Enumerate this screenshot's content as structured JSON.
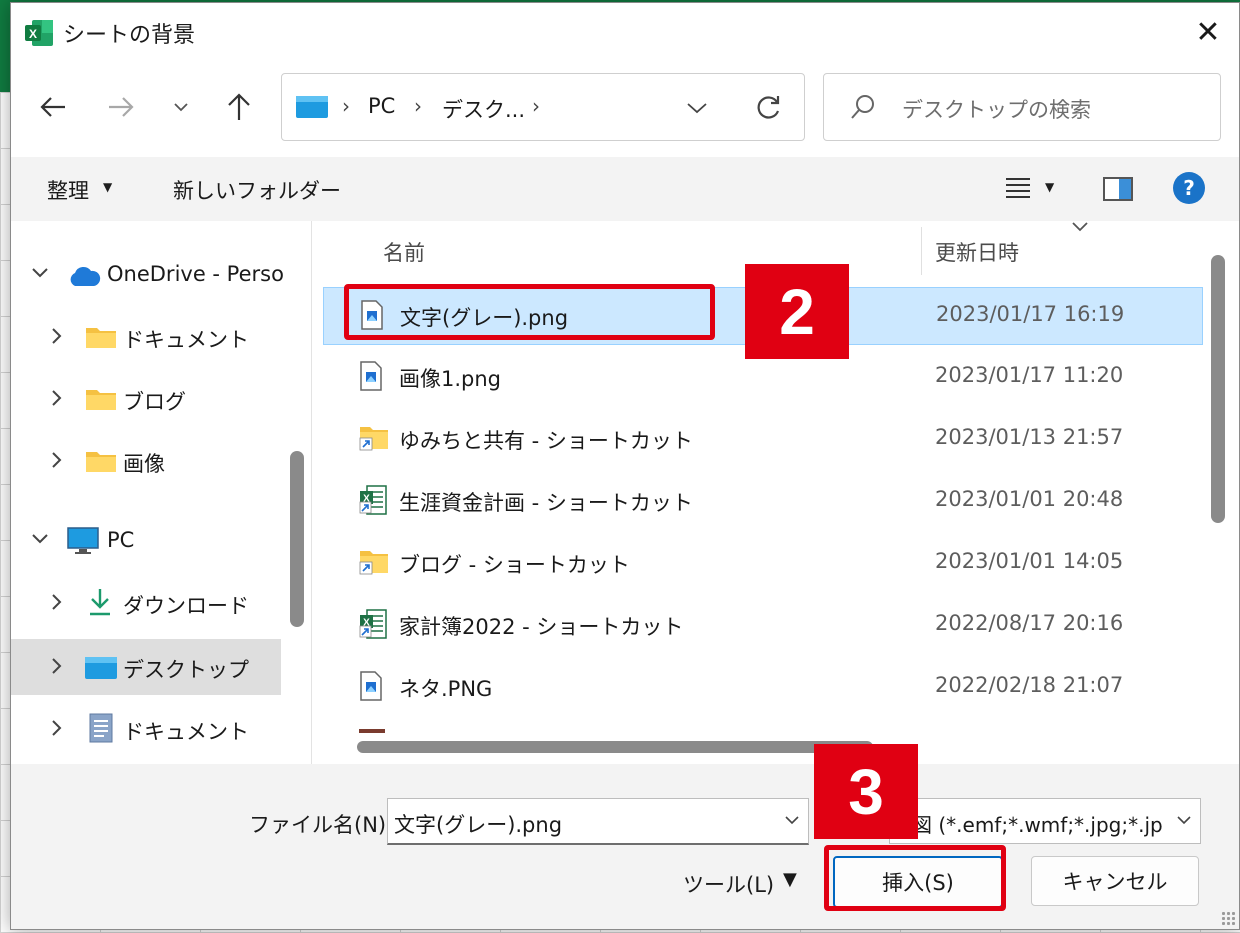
{
  "dialog": {
    "title": "シートの背景",
    "close_glyph": "✕"
  },
  "nav": {
    "breadcrumb": [
      "PC",
      "デスク..."
    ],
    "breadcrumb_sep": "›",
    "search_placeholder": "デスクトップの検索"
  },
  "toolbar": {
    "organize_label": "整理",
    "new_folder_label": "新しいフォルダー",
    "help_glyph": "?"
  },
  "tree": {
    "items": [
      {
        "label": "OneDrive - Perso",
        "expanded": true,
        "icon": "cloud-icon"
      },
      {
        "label": "ドキュメント",
        "icon": "folder-icon"
      },
      {
        "label": "ブログ",
        "icon": "folder-icon"
      },
      {
        "label": "画像",
        "icon": "folder-icon"
      },
      {
        "label": "PC",
        "expanded": true,
        "icon": "monitor-icon"
      },
      {
        "label": "ダウンロード",
        "icon": "download-icon"
      },
      {
        "label": "デスクトップ",
        "icon": "desktop-icon",
        "selected": true
      },
      {
        "label": "ドキュメント",
        "icon": "document-icon"
      }
    ]
  },
  "files": {
    "columns": {
      "name": "名前",
      "modified": "更新日時"
    },
    "rows": [
      {
        "name": "文字(グレー).png",
        "date": "2023/01/17 16:19",
        "icon": "image-file-icon",
        "selected": true
      },
      {
        "name": "画像1.png",
        "date": "2023/01/17 11:20",
        "icon": "image-file-icon"
      },
      {
        "name": "ゆみちと共有 - ショートカット",
        "date": "2023/01/13 21:57",
        "icon": "folder-shortcut-icon"
      },
      {
        "name": "生涯資金計画 - ショートカット",
        "date": "2023/01/01 20:48",
        "icon": "excel-shortcut-icon"
      },
      {
        "name": "ブログ - ショートカット",
        "date": "2023/01/01 14:05",
        "icon": "folder-shortcut-icon"
      },
      {
        "name": "家計簿2022 - ショートカット",
        "date": "2022/08/17 20:16",
        "icon": "excel-shortcut-icon"
      },
      {
        "name": "ネタ.PNG",
        "date": "2022/02/18 21:07",
        "icon": "image-file-icon"
      }
    ]
  },
  "footer": {
    "filename_label": "ファイル名(N):",
    "filename_value": "文字(グレー).png",
    "filter_value": "図 (*.emf;*.wmf;*.jpg;*.jp",
    "tools_label": "ツール(L)",
    "insert_label": "挿入(S)",
    "cancel_label": "キャンセル"
  },
  "annotations": {
    "step2": "2",
    "step3": "3"
  },
  "colors": {
    "excel_green": "#107c41",
    "selection": "#cce8ff",
    "accent": "#0067c0",
    "annotation_red": "#e00012"
  }
}
